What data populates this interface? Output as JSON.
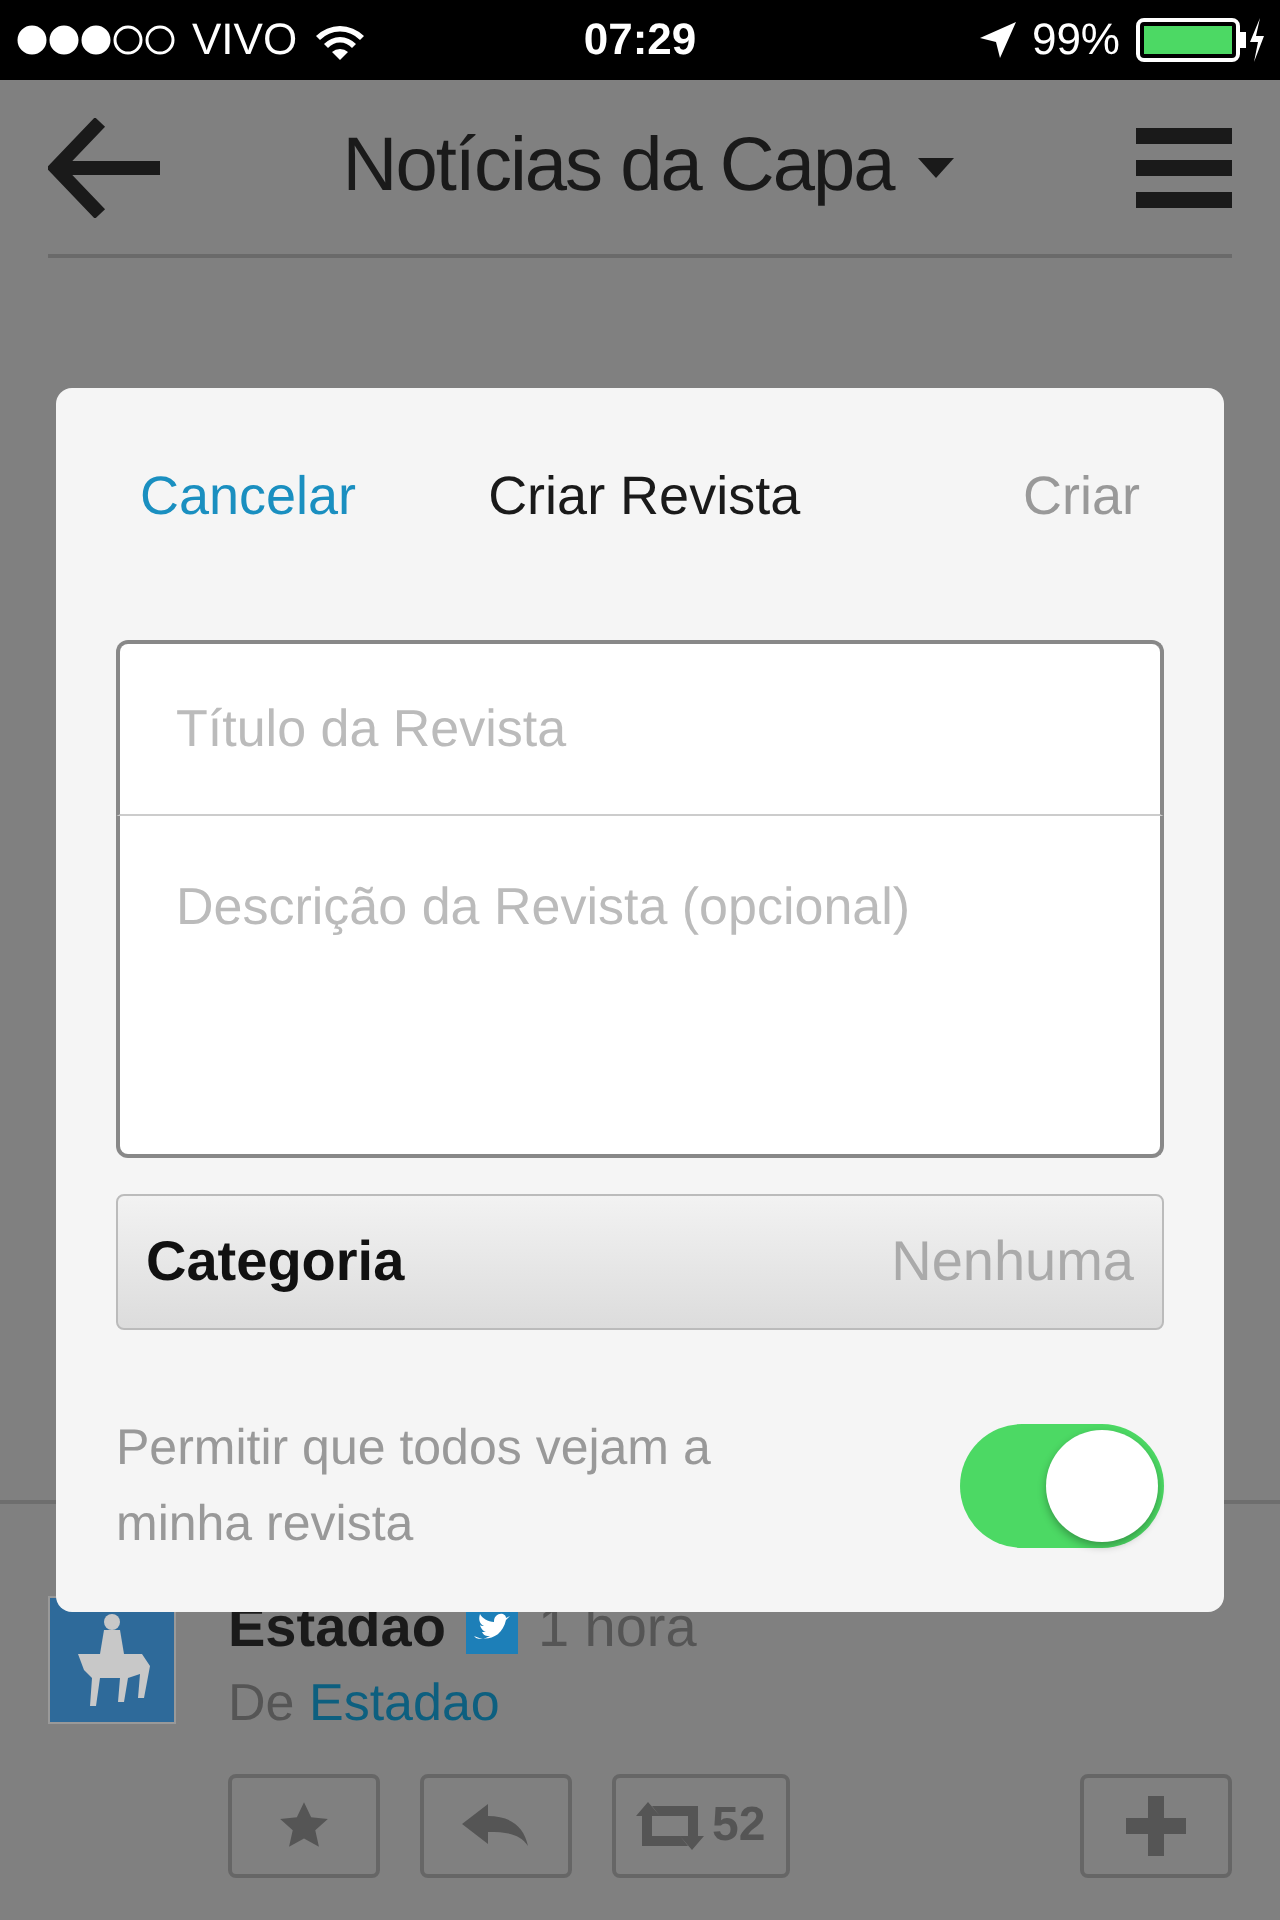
{
  "status_bar": {
    "carrier": "VIVO",
    "time": "07:29",
    "battery": "99%"
  },
  "nav": {
    "title": "Notícias da Capa"
  },
  "feed_item": {
    "source": "Estadao",
    "time": "1 hora",
    "from_prefix": "De",
    "from_link": "Estadao",
    "actions": [
      {
        "kind": "star"
      },
      {
        "kind": "reply"
      },
      {
        "kind": "retweet",
        "count": "52"
      },
      {
        "kind": "add"
      }
    ]
  },
  "dialog": {
    "cancel": "Cancelar",
    "title": "Criar Revista",
    "create": {
      "label": "Criar",
      "disabled": true
    },
    "title_field": {
      "placeholder": "Título da Revista"
    },
    "description_field": {
      "placeholder": "Descrição da Revista (opcional)"
    },
    "category": {
      "label": "Categoria",
      "value": "Nenhuma"
    },
    "public_toggle": {
      "label": "Permitir que todos vejam a minha revista",
      "on": true
    }
  }
}
